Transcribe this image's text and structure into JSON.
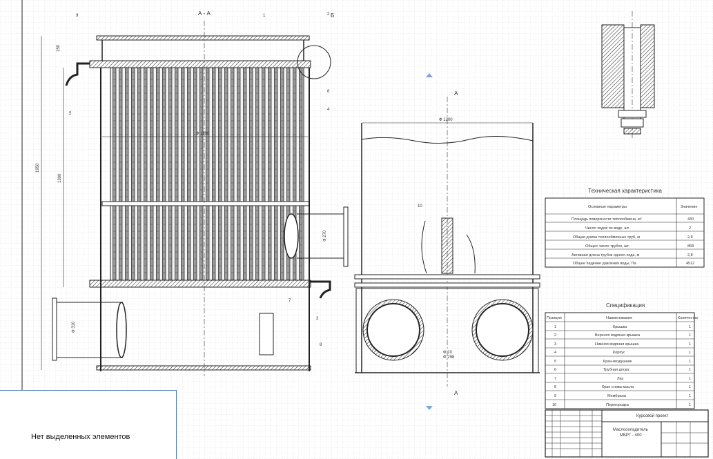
{
  "section_label": "А - А",
  "callouts": [
    "1",
    "2",
    "3",
    "4",
    "5",
    "6",
    "7",
    "8",
    "9",
    "10"
  ],
  "detail_label": "Б",
  "dimensions": {
    "overall_height": "1950",
    "tube_length": "1300",
    "top_offset": "150",
    "shell_diameter": "Ф 1190",
    "outer_diameter": "Ф 1200",
    "nozzle_lower": "Ф 310",
    "nozzle_upper": "Ф 270",
    "cut_dia_a": "Ф 10",
    "cut_dia_b": "Ф 298"
  },
  "cut_marker": "А",
  "tech": {
    "title": "Техническая характеристика",
    "col_param": "Основные параметры",
    "col_value": "Значение",
    "rows": [
      {
        "param": "Площадь поверхности теплообмена, м²",
        "value": "430"
      },
      {
        "param": "Число ходов по воде, шт.",
        "value": "2"
      },
      {
        "param": "Общая длина теплообменных труб, м",
        "value": "2,8"
      },
      {
        "param": "Общее число трубок, шт.",
        "value": "868"
      },
      {
        "param": "Активная длина трубок одного хода, м",
        "value": "2,8"
      },
      {
        "param": "Общее падение давления воды, Па",
        "value": "4512"
      }
    ]
  },
  "spec": {
    "title": "Спецификация",
    "col_pos": "Позиция",
    "col_name": "Наименование",
    "col_qty": "Количество",
    "rows": [
      {
        "pos": "1",
        "name": "Крышка",
        "qty": "1"
      },
      {
        "pos": "2",
        "name": "Верхняя водяная крышка",
        "qty": "1"
      },
      {
        "pos": "3",
        "name": "Нижняя водяная крышка",
        "qty": "1"
      },
      {
        "pos": "4",
        "name": "Корпус",
        "qty": "1"
      },
      {
        "pos": "5",
        "name": "Кран-воздушник",
        "qty": "1"
      },
      {
        "pos": "6",
        "name": "Трубная доска",
        "qty": "1"
      },
      {
        "pos": "7",
        "name": "Лаз",
        "qty": "1"
      },
      {
        "pos": "8",
        "name": "Кран слива масла",
        "qty": "1"
      },
      {
        "pos": "9",
        "name": "Мембрана",
        "qty": "1"
      },
      {
        "pos": "10",
        "name": "Перегородка",
        "qty": "1"
      }
    ]
  },
  "stamp": {
    "project": "Курсовой проект",
    "name_line1": "Маслоохладитель",
    "name_line2": "МБРГ - 400"
  },
  "status_panel": {
    "text": "Нет выделенных элементов"
  }
}
